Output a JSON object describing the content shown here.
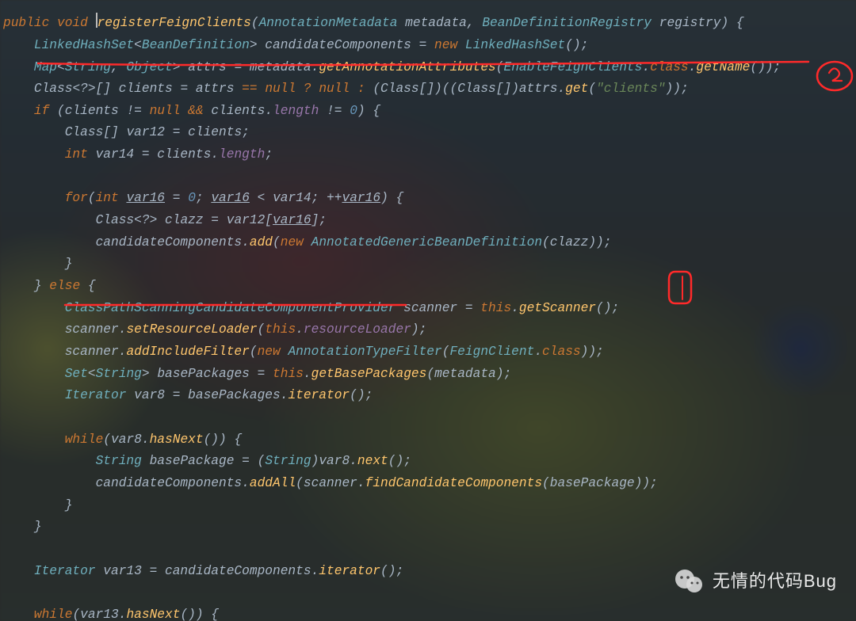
{
  "watermark": {
    "text": "无情的代码Bug"
  },
  "code": {
    "lines": [
      [
        {
          "cls": "kw",
          "t": "public "
        },
        {
          "cls": "kw",
          "t": "void "
        },
        {
          "cursor": true
        },
        {
          "cls": "mth",
          "t": "registerFeignClients"
        },
        {
          "cls": "par",
          "t": "("
        },
        {
          "cls": "cls",
          "t": "AnnotationMetadata"
        },
        {
          "cls": "id",
          "t": " metadata, "
        },
        {
          "cls": "cls",
          "t": "BeanDefinitionRegistry"
        },
        {
          "cls": "id",
          "t": " registry"
        },
        {
          "cls": "par",
          "t": ") {"
        }
      ],
      [
        {
          "t": "    "
        },
        {
          "cls": "cls",
          "t": "LinkedHashSet"
        },
        {
          "cls": "op",
          "t": "<"
        },
        {
          "cls": "cls",
          "t": "BeanDefinition"
        },
        {
          "cls": "op",
          "t": ">"
        },
        {
          "cls": "id",
          "t": " candidateComponents = "
        },
        {
          "cls": "kw",
          "t": "new "
        },
        {
          "cls": "cls",
          "t": "LinkedHashSet"
        },
        {
          "cls": "par",
          "t": "();"
        }
      ],
      [
        {
          "t": "    "
        },
        {
          "cls": "cls",
          "t": "Map"
        },
        {
          "cls": "op",
          "t": "<"
        },
        {
          "cls": "cls",
          "t": "String"
        },
        {
          "cls": "op",
          "t": ", "
        },
        {
          "cls": "cls",
          "t": "Object"
        },
        {
          "cls": "op",
          "t": ">"
        },
        {
          "cls": "id",
          "t": " attrs = metadata."
        },
        {
          "cls": "mth",
          "t": "getAnnotationAttributes"
        },
        {
          "cls": "par",
          "t": "("
        },
        {
          "cls": "cls",
          "t": "EnableFeignClients"
        },
        {
          "cls": "op",
          "t": "."
        },
        {
          "cls": "kw",
          "t": "class"
        },
        {
          "cls": "op",
          "t": "."
        },
        {
          "cls": "mth",
          "t": "getName"
        },
        {
          "cls": "par",
          "t": "());"
        }
      ],
      [
        {
          "t": "    "
        },
        {
          "cls": "ty",
          "t": "Class"
        },
        {
          "cls": "op",
          "t": "<?>[] "
        },
        {
          "cls": "id",
          "t": "clients = attrs "
        },
        {
          "cls": "kw",
          "t": "== null ? null : "
        },
        {
          "cls": "par",
          "t": "("
        },
        {
          "cls": "ty",
          "t": "Class"
        },
        {
          "cls": "par",
          "t": "[])(("
        },
        {
          "cls": "ty",
          "t": "Class"
        },
        {
          "cls": "par",
          "t": "[])"
        },
        {
          "cls": "id",
          "t": "attrs."
        },
        {
          "cls": "mth",
          "t": "get"
        },
        {
          "cls": "par",
          "t": "("
        },
        {
          "cls": "str",
          "t": "\"clients\""
        },
        {
          "cls": "par",
          "t": "));"
        }
      ],
      [
        {
          "t": "    "
        },
        {
          "cls": "kw",
          "t": "if "
        },
        {
          "cls": "par",
          "t": "("
        },
        {
          "cls": "id",
          "t": "clients != "
        },
        {
          "cls": "kw",
          "t": "null "
        },
        {
          "cls": "kw",
          "t": "&& "
        },
        {
          "cls": "id",
          "t": "clients."
        },
        {
          "cls": "field",
          "t": "length"
        },
        {
          "cls": "id",
          "t": " != "
        },
        {
          "cls": "num",
          "t": "0"
        },
        {
          "cls": "par",
          "t": ") {"
        }
      ],
      [
        {
          "t": "        "
        },
        {
          "cls": "ty",
          "t": "Class"
        },
        {
          "cls": "par",
          "t": "[] "
        },
        {
          "cls": "id",
          "t": "var12 = clients;"
        }
      ],
      [
        {
          "t": "        "
        },
        {
          "cls": "kw",
          "t": "int "
        },
        {
          "cls": "id",
          "t": "var14 = clients."
        },
        {
          "cls": "field",
          "t": "length"
        },
        {
          "cls": "id",
          "t": ";"
        }
      ],
      [
        {
          "t": " "
        }
      ],
      [
        {
          "t": "        "
        },
        {
          "cls": "kw",
          "t": "for"
        },
        {
          "cls": "par",
          "t": "("
        },
        {
          "cls": "kw",
          "t": "int "
        },
        {
          "cls": "uvar",
          "t": "var16"
        },
        {
          "cls": "id",
          "t": " = "
        },
        {
          "cls": "num",
          "t": "0"
        },
        {
          "cls": "id",
          "t": "; "
        },
        {
          "cls": "uvar",
          "t": "var16"
        },
        {
          "cls": "id",
          "t": " < var14; ++"
        },
        {
          "cls": "uvar",
          "t": "var16"
        },
        {
          "cls": "par",
          "t": ") {"
        }
      ],
      [
        {
          "t": "            "
        },
        {
          "cls": "ty",
          "t": "Class"
        },
        {
          "cls": "op",
          "t": "<?> "
        },
        {
          "cls": "id",
          "t": "clazz = var12["
        },
        {
          "cls": "uvar",
          "t": "var16"
        },
        {
          "cls": "id",
          "t": "];"
        }
      ],
      [
        {
          "t": "            "
        },
        {
          "cls": "id",
          "t": "candidateComponents."
        },
        {
          "cls": "mth",
          "t": "add"
        },
        {
          "cls": "par",
          "t": "("
        },
        {
          "cls": "kw",
          "t": "new "
        },
        {
          "cls": "cls",
          "t": "AnnotatedGenericBeanDefinition"
        },
        {
          "cls": "par",
          "t": "("
        },
        {
          "cls": "id",
          "t": "clazz"
        },
        {
          "cls": "par",
          "t": "));"
        }
      ],
      [
        {
          "t": "        "
        },
        {
          "cls": "par",
          "t": "}"
        }
      ],
      [
        {
          "t": "    "
        },
        {
          "cls": "par",
          "t": "} "
        },
        {
          "cls": "kw",
          "t": "else "
        },
        {
          "cls": "par",
          "t": "{"
        }
      ],
      [
        {
          "t": "        "
        },
        {
          "cls": "cls",
          "t": "ClassPathScanningCandidateComponentProvider"
        },
        {
          "cls": "id",
          "t": " scanner = "
        },
        {
          "cls": "this",
          "t": "this"
        },
        {
          "cls": "id",
          "t": "."
        },
        {
          "cls": "mth",
          "t": "getScanner"
        },
        {
          "cls": "par",
          "t": "();"
        }
      ],
      [
        {
          "t": "        "
        },
        {
          "cls": "id",
          "t": "scanner."
        },
        {
          "cls": "mth",
          "t": "setResourceLoader"
        },
        {
          "cls": "par",
          "t": "("
        },
        {
          "cls": "this",
          "t": "this"
        },
        {
          "cls": "id",
          "t": "."
        },
        {
          "cls": "field",
          "t": "resourceLoader"
        },
        {
          "cls": "par",
          "t": ");"
        }
      ],
      [
        {
          "t": "        "
        },
        {
          "cls": "id",
          "t": "scanner."
        },
        {
          "cls": "mth",
          "t": "addIncludeFilter"
        },
        {
          "cls": "par",
          "t": "("
        },
        {
          "cls": "kw",
          "t": "new "
        },
        {
          "cls": "cls",
          "t": "AnnotationTypeFilter"
        },
        {
          "cls": "par",
          "t": "("
        },
        {
          "cls": "cls",
          "t": "FeignClient"
        },
        {
          "cls": "op",
          "t": "."
        },
        {
          "cls": "kw",
          "t": "class"
        },
        {
          "cls": "par",
          "t": "));"
        }
      ],
      [
        {
          "t": "        "
        },
        {
          "cls": "cls",
          "t": "Set"
        },
        {
          "cls": "op",
          "t": "<"
        },
        {
          "cls": "cls",
          "t": "String"
        },
        {
          "cls": "op",
          "t": "> "
        },
        {
          "cls": "id",
          "t": "basePackages = "
        },
        {
          "cls": "this",
          "t": "this"
        },
        {
          "cls": "id",
          "t": "."
        },
        {
          "cls": "mth",
          "t": "getBasePackages"
        },
        {
          "cls": "par",
          "t": "("
        },
        {
          "cls": "id",
          "t": "metadata"
        },
        {
          "cls": "par",
          "t": ");"
        }
      ],
      [
        {
          "t": "        "
        },
        {
          "cls": "cls",
          "t": "Iterator"
        },
        {
          "cls": "id",
          "t": " var8 = basePackages."
        },
        {
          "cls": "mth",
          "t": "iterator"
        },
        {
          "cls": "par",
          "t": "();"
        }
      ],
      [
        {
          "t": " "
        }
      ],
      [
        {
          "t": "        "
        },
        {
          "cls": "kw",
          "t": "while"
        },
        {
          "cls": "par",
          "t": "("
        },
        {
          "cls": "id",
          "t": "var8."
        },
        {
          "cls": "mth",
          "t": "hasNext"
        },
        {
          "cls": "par",
          "t": "()) {"
        }
      ],
      [
        {
          "t": "            "
        },
        {
          "cls": "cls",
          "t": "String"
        },
        {
          "cls": "id",
          "t": " basePackage = "
        },
        {
          "cls": "par",
          "t": "("
        },
        {
          "cls": "cls",
          "t": "String"
        },
        {
          "cls": "par",
          "t": ")"
        },
        {
          "cls": "id",
          "t": "var8."
        },
        {
          "cls": "mth",
          "t": "next"
        },
        {
          "cls": "par",
          "t": "();"
        }
      ],
      [
        {
          "t": "            "
        },
        {
          "cls": "id",
          "t": "candidateComponents."
        },
        {
          "cls": "mth",
          "t": "addAll"
        },
        {
          "cls": "par",
          "t": "("
        },
        {
          "cls": "id",
          "t": "scanner."
        },
        {
          "cls": "mth",
          "t": "findCandidateComponents"
        },
        {
          "cls": "par",
          "t": "("
        },
        {
          "cls": "id",
          "t": "basePackage"
        },
        {
          "cls": "par",
          "t": "));"
        }
      ],
      [
        {
          "t": "        "
        },
        {
          "cls": "par",
          "t": "}"
        }
      ],
      [
        {
          "t": "    "
        },
        {
          "cls": "par",
          "t": "}"
        }
      ],
      [
        {
          "t": " "
        }
      ],
      [
        {
          "t": "    "
        },
        {
          "cls": "cls",
          "t": "Iterator"
        },
        {
          "cls": "id",
          "t": " var13 = candidateComponents."
        },
        {
          "cls": "mth",
          "t": "iterator"
        },
        {
          "cls": "par",
          "t": "();"
        }
      ],
      [
        {
          "t": " "
        }
      ],
      [
        {
          "t": "    "
        },
        {
          "cls": "kw",
          "t": "while"
        },
        {
          "cls": "par",
          "t": "("
        },
        {
          "cls": "id",
          "t": "var13."
        },
        {
          "cls": "mth",
          "t": "hasNext"
        },
        {
          "cls": "par",
          "t": "()) {"
        }
      ]
    ]
  }
}
